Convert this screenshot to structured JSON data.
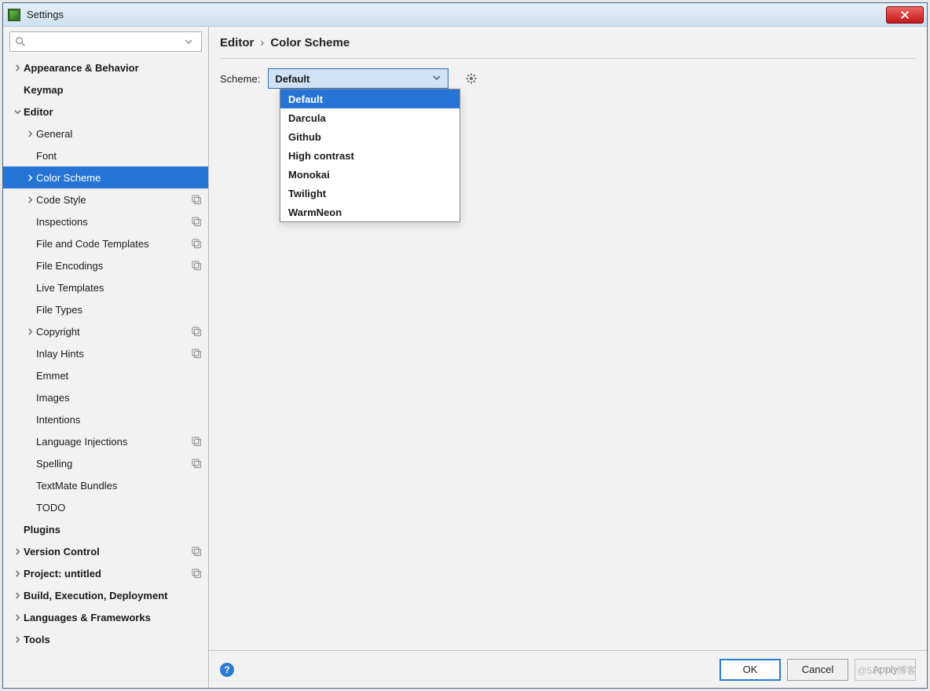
{
  "window": {
    "title": "Settings"
  },
  "sidebar": {
    "search_placeholder": "",
    "items": [
      {
        "label": "Appearance & Behavior",
        "depth": 0,
        "bold": true,
        "arrow": "right"
      },
      {
        "label": "Keymap",
        "depth": 0,
        "bold": true
      },
      {
        "label": "Editor",
        "depth": 0,
        "bold": true,
        "arrow": "down"
      },
      {
        "label": "General",
        "depth": 1,
        "arrow": "right"
      },
      {
        "label": "Font",
        "depth": 1
      },
      {
        "label": "Color Scheme",
        "depth": 1,
        "arrow": "right",
        "selected": true
      },
      {
        "label": "Code Style",
        "depth": 1,
        "arrow": "right",
        "trailing": true
      },
      {
        "label": "Inspections",
        "depth": 1,
        "trailing": true
      },
      {
        "label": "File and Code Templates",
        "depth": 1,
        "trailing": true
      },
      {
        "label": "File Encodings",
        "depth": 1,
        "trailing": true
      },
      {
        "label": "Live Templates",
        "depth": 1
      },
      {
        "label": "File Types",
        "depth": 1
      },
      {
        "label": "Copyright",
        "depth": 1,
        "arrow": "right",
        "trailing": true
      },
      {
        "label": "Inlay Hints",
        "depth": 1,
        "trailing": true
      },
      {
        "label": "Emmet",
        "depth": 1
      },
      {
        "label": "Images",
        "depth": 1
      },
      {
        "label": "Intentions",
        "depth": 1
      },
      {
        "label": "Language Injections",
        "depth": 1,
        "trailing": true
      },
      {
        "label": "Spelling",
        "depth": 1,
        "trailing": true
      },
      {
        "label": "TextMate Bundles",
        "depth": 1
      },
      {
        "label": "TODO",
        "depth": 1
      },
      {
        "label": "Plugins",
        "depth": 0,
        "bold": true
      },
      {
        "label": "Version Control",
        "depth": 0,
        "bold": true,
        "arrow": "right",
        "trailing": true
      },
      {
        "label": "Project: untitled",
        "depth": 0,
        "bold": true,
        "arrow": "right",
        "trailing": true
      },
      {
        "label": "Build, Execution, Deployment",
        "depth": 0,
        "bold": true,
        "arrow": "right"
      },
      {
        "label": "Languages & Frameworks",
        "depth": 0,
        "bold": true,
        "arrow": "right"
      },
      {
        "label": "Tools",
        "depth": 0,
        "bold": true,
        "arrow": "right"
      }
    ]
  },
  "breadcrumb": {
    "parent": "Editor",
    "child": "Color Scheme"
  },
  "scheme": {
    "label": "Scheme:",
    "value": "Default",
    "options": [
      "Default",
      "Darcula",
      "Github",
      "High contrast",
      "Monokai",
      "Twilight",
      "WarmNeon"
    ],
    "selected_index": 0
  },
  "footer": {
    "ok": "OK",
    "cancel": "Cancel",
    "apply": "Apply"
  },
  "watermark": "@51CTO博客"
}
